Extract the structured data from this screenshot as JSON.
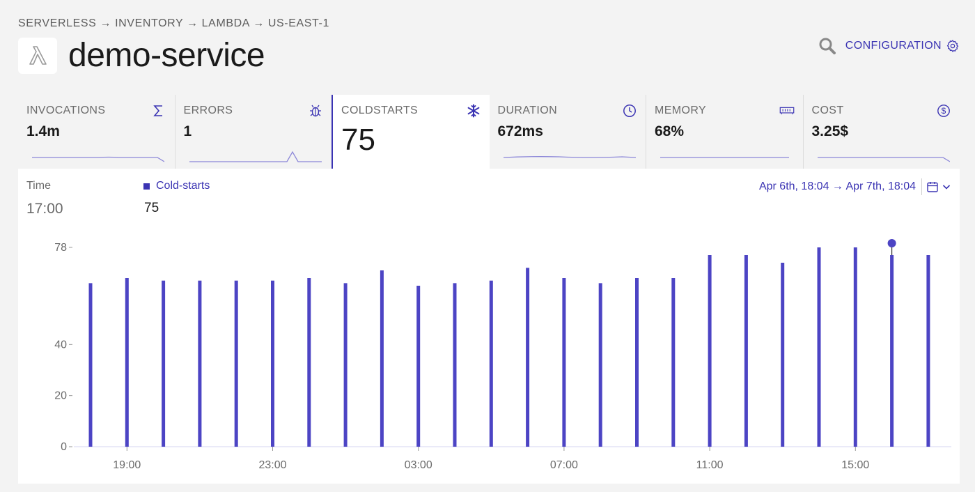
{
  "breadcrumb": "SERVERLESS → INVENTORY → LAMBDA → US-EAST-1",
  "title": "demo-service",
  "header": {
    "config_label": "CONFIGURATION"
  },
  "metrics": [
    {
      "label": "INVOCATIONS",
      "value": "1.4m",
      "icon": "sigma-icon"
    },
    {
      "label": "ERRORS",
      "value": "1",
      "icon": "bug-icon"
    },
    {
      "label": "COLDSTARTS",
      "value": "75",
      "icon": "snowflake-icon",
      "active": true
    },
    {
      "label": "DURATION",
      "value": "672ms",
      "icon": "clock-icon"
    },
    {
      "label": "MEMORY",
      "value": "68%",
      "icon": "memory-icon"
    },
    {
      "label": "COST",
      "value": "3.25$",
      "icon": "dollar-icon"
    }
  ],
  "tooltip": {
    "time_label": "Time",
    "time_value": "17:00",
    "series_label": "Cold-starts",
    "series_value": "75"
  },
  "range": {
    "text": "Apr 6th, 18:04 → Apr 7th, 18:04"
  },
  "colors": {
    "accent": "#3b34b3",
    "bar": "#4c44c4",
    "background": "#f3f3f3",
    "panel": "#ffffff"
  },
  "chart_data": {
    "type": "bar",
    "series": [
      {
        "name": "Cold-starts",
        "x": [
          "18:00",
          "19:00",
          "20:00",
          "21:00",
          "22:00",
          "23:00",
          "00:00",
          "01:00",
          "02:00",
          "03:00",
          "04:00",
          "05:00",
          "06:00",
          "07:00",
          "08:00",
          "09:00",
          "10:00",
          "11:00",
          "12:00",
          "13:00",
          "14:00",
          "15:00",
          "16:00",
          "17:00"
        ],
        "values": [
          64,
          66,
          65,
          65,
          65,
          65,
          66,
          64,
          69,
          63,
          64,
          65,
          70,
          66,
          64,
          66,
          66,
          75,
          75,
          72,
          78,
          78,
          75,
          75
        ]
      }
    ],
    "y_ticks": [
      0,
      20,
      40,
      78
    ],
    "x_ticks": [
      "19:00",
      "23:00",
      "03:00",
      "07:00",
      "11:00",
      "15:00"
    ],
    "ylim": [
      0,
      78
    ],
    "highlight_index": 22
  }
}
